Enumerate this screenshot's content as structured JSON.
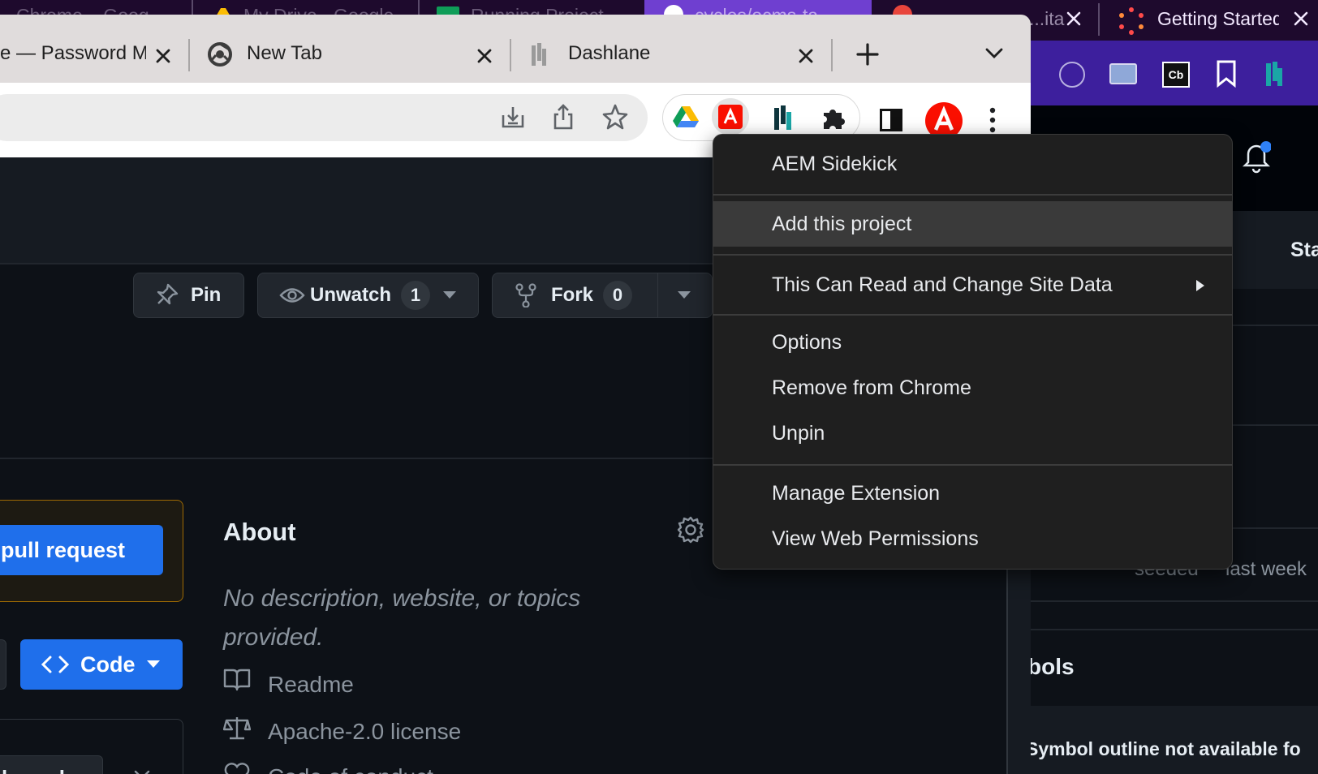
{
  "back_window": {
    "tabs": [
      {
        "title": "Chrome... Goog..."
      },
      {
        "title": "My Drive - Google..."
      },
      {
        "title": "Running Project..."
      },
      {
        "title": "cycles/ocms-ta..."
      },
      {
        "title": "...ita"
      },
      {
        "title": "Getting Started"
      }
    ],
    "sidebar": {
      "star_label": "Sta",
      "last_week_label": "last week",
      "seeded_label": "seeded",
      "symbols_heading": "bols",
      "symbol_note": "Symbol outline not available fo"
    }
  },
  "front_window": {
    "tabs": [
      {
        "title": "e — Password M"
      },
      {
        "title": "New Tab"
      },
      {
        "title": "Dashlane"
      }
    ]
  },
  "github": {
    "pin_label": "Pin",
    "unwatch_label": "Unwatch",
    "unwatch_count": "1",
    "fork_label": "Fork",
    "fork_count": "0",
    "pull_request_label": "pull request",
    "code_label": "Code",
    "branch_label": "branch",
    "about": {
      "title": "About",
      "description": "No description, website, or topics provided.",
      "links": [
        {
          "label": "Readme",
          "icon": "book-icon"
        },
        {
          "label": "Apache-2.0 license",
          "icon": "scale-icon"
        },
        {
          "label": "Code of conduct",
          "icon": "heart-icon"
        }
      ]
    }
  },
  "context_menu": {
    "items": [
      {
        "label": "AEM Sidekick"
      },
      {
        "label": "Add this project"
      },
      {
        "label": "This Can Read and Change Site Data"
      },
      {
        "label": "Options"
      },
      {
        "label": "Remove from Chrome"
      },
      {
        "label": "Unpin"
      },
      {
        "label": "Manage Extension"
      },
      {
        "label": "View Web Permissions"
      }
    ]
  },
  "colors": {
    "accent_blue": "#1f6feb",
    "adobe_red": "#fa0f00",
    "menu_bg": "#1f1f1f",
    "back_toolbar": "#3d1f9d"
  }
}
